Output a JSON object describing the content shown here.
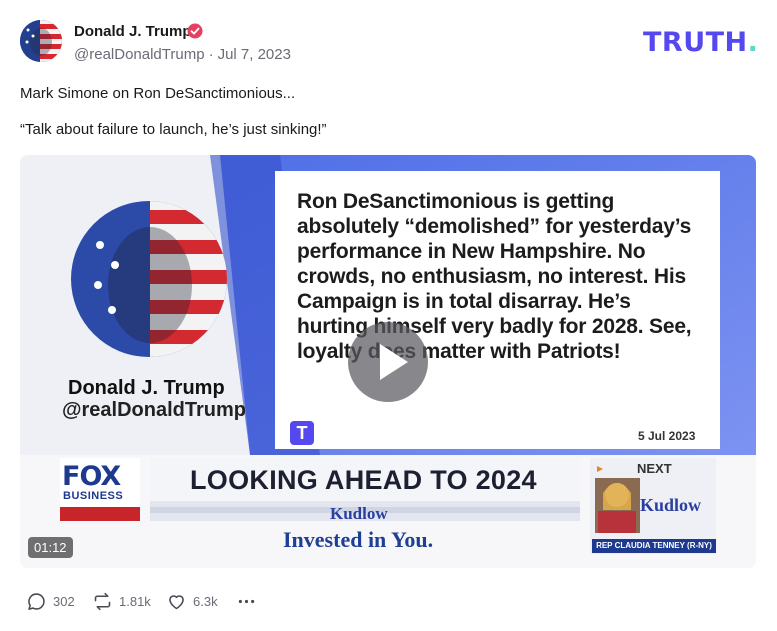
{
  "author": {
    "name": "Donald J. Trump",
    "handle": "@realDonaldTrump",
    "date": "Jul 7, 2023",
    "verified": true
  },
  "brand": {
    "logo_text": "TRUTH",
    "logo_dot": ".",
    "color": "#5448ee",
    "dot_color": "#63d6c5"
  },
  "post": {
    "line1": "Mark Simone on Ron DeSanctimonious...",
    "line2": "“Talk about failure to launch, he’s just sinking!”"
  },
  "video": {
    "duration": "01:12",
    "card": {
      "name": "Donald J. Trump",
      "handle": "@realDonaldTrump"
    },
    "quote": "Ron DeSanctimonious is getting absolutely “demolished” for yesterday’s performance in New Hampshire. No crowds, no enthusiasm, no interest. His Campaign is in total disarray. He’s hurting himself very badly for 2028. See, loyalty does matter with Patriots!",
    "quote_date": "5 Jul 2023",
    "network": "FOX",
    "network_sub": "BUSINESS",
    "banner": "LOOKING AHEAD TO 2024",
    "show": "Kudlow",
    "tagline": "Invested in You.",
    "next_label": "NEXT",
    "next_show": "Kudlow",
    "next_caption": "REP CLAUDIA TENNEY (R-NY)"
  },
  "actions": {
    "replies": "302",
    "retruths": "1.81k",
    "likes": "6.3k"
  }
}
